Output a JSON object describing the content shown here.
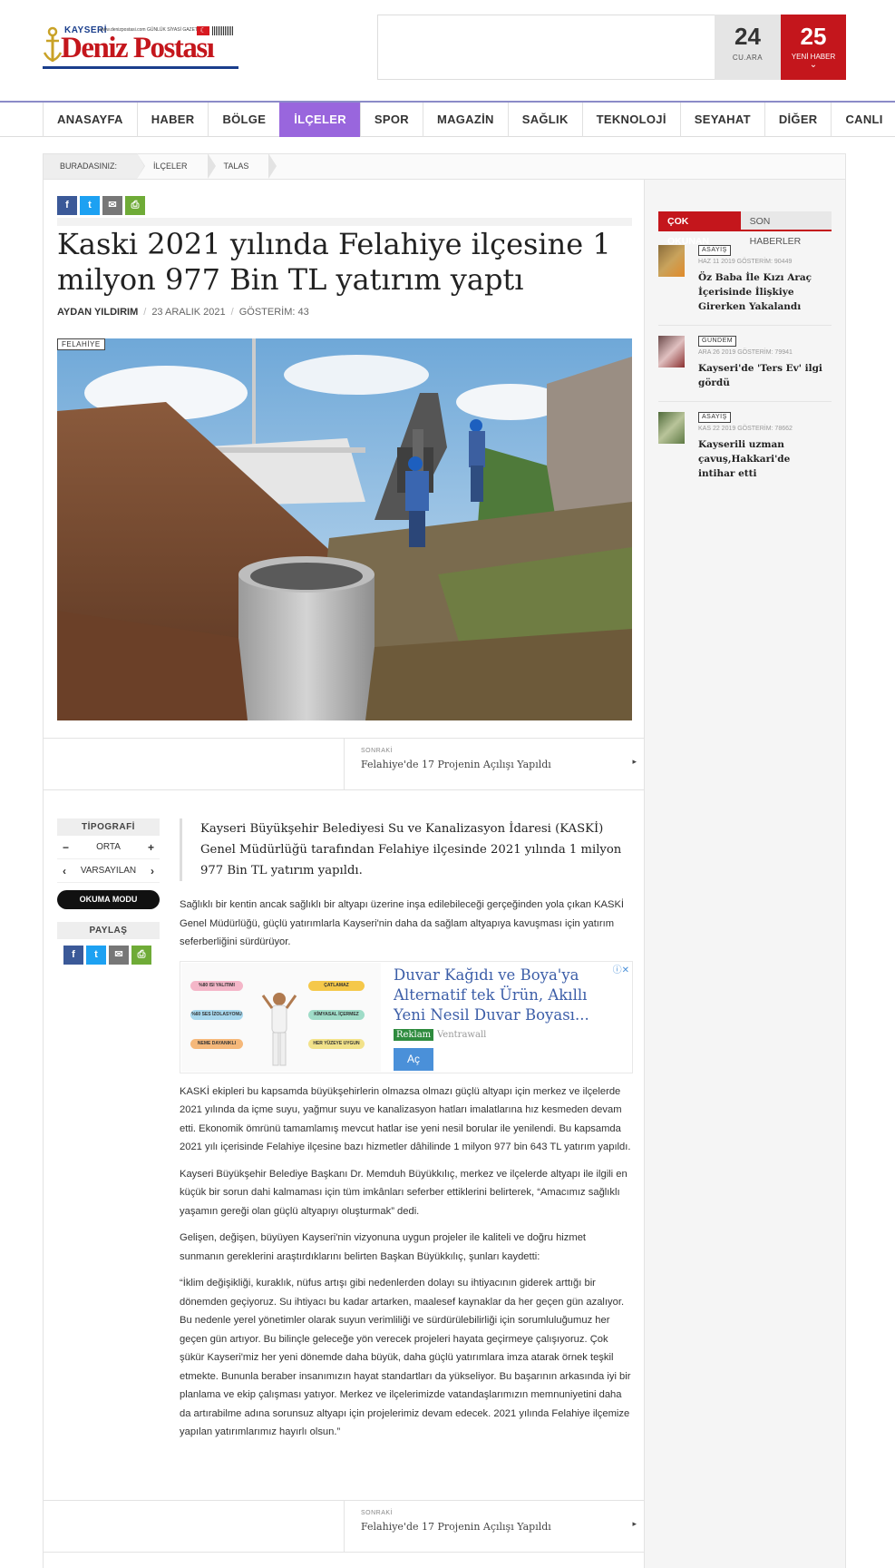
{
  "header": {
    "logo": {
      "top": "KAYSERİ",
      "main": "Deniz Postası",
      "tagline": "www.denizpostasi.com  GÜNLÜK SİYASİ GAZETE"
    },
    "date": {
      "day": "24",
      "weekday": "CU.ARA"
    },
    "news": {
      "count": "25",
      "label": "YENİ HABER"
    }
  },
  "nav": [
    "ANASAYFA",
    "HABER",
    "BÖLGE",
    "İLÇELER",
    "SPOR",
    "MAGAZİN",
    "SAĞLIK",
    "TEKNOLOJİ",
    "SEYAHAT",
    "DİĞER",
    "CANLI"
  ],
  "breadcrumb": [
    "BURADASINIZ:",
    "İLÇELER",
    "TALAS"
  ],
  "article": {
    "title": "Kaski 2021 yılında Felahiye ilçesine 1 milyon 977 Bin TL yatırım yaptı",
    "author": "AYDAN YILDIRIM",
    "date": "23 ARALIK 2021",
    "views": "GÖSTERİM: 43",
    "category": "FELAHİYE",
    "lead": "Kayseri Büyükşehir Belediyesi Su ve Kanalizasyon İdaresi (KASKİ) Genel Müdürlüğü tarafından Felahiye ilçesinde 2021 yılında 1 milyon 977 Bin TL yatırım yapıldı.",
    "paragraphs": [
      "Sağlıklı bir kentin ancak sağlıklı bir altyapı üzerine inşa edilebileceği gerçeğinden yola çıkan KASKİ Genel Müdürlüğü, güçlü yatırımlarla Kayseri'nin daha da sağlam altyapıya kavuşması için yatırım seferberliğini sürdürüyor.",
      "KASKİ ekipleri bu kapsamda büyükşehirlerin olmazsa olmazı güçlü altyapı için merkez ve ilçelerde 2021 yılında da içme suyu, yağmur suyu ve kanalizasyon hatları imalatlarına hız kesmeden devam etti. Ekonomik ömrünü tamamlamış mevcut hatlar ise yeni nesil borular ile yenilendi. Bu kapsamda 2021 yılı içerisinde Felahiye ilçesine bazı hizmetler dâhilinde 1 milyon 977 bin 643 TL yatırım yapıldı.",
      "Kayseri Büyükşehir Belediye Başkanı Dr. Memduh Büyükkılıç, merkez ve ilçelerde altyapı ile ilgili en küçük bir sorun dahi kalmaması için tüm imkânları seferber ettiklerini belirterek, “Amacımız sağlıklı yaşamın gereği olan güçlü altyapıyı oluşturmak” dedi.",
      "Gelişen, değişen, büyüyen Kayseri'nin vizyonuna uygun projeler ile kaliteli ve doğru hizmet sunmanın gereklerini araştırdıklarını belirten Başkan Büyükkılıç, şunları kaydetti:",
      "“İklim değişikliği, kuraklık, nüfus artışı gibi nedenlerden dolayı su ihtiyacının giderek arttığı bir dönemden geçiyoruz. Su ihtiyacı bu kadar artarken, maalesef kaynaklar da her geçen gün azalıyor. Bu nedenle yerel yönetimler olarak suyun verimliliği ve sürdürülebilirliği için sorumluluğumuz her geçen gün artıyor. Bu bilinçle geleceğe yön verecek projeleri hayata geçirmeye çalışıyoruz. Çok şükür Kayseri'miz her yeni dönemde daha büyük, daha güçlü yatırımlara imza atarak örnek teşkil etmekte. Bununla beraber insanımızın hayat standartları da yükseliyor. Bu başarının arkasında iyi bir planlama ve ekip çalışması yatıyor. Merkez ve ilçelerimizde vatandaşlarımızın memnuniyetini daha da artırabilme adına sorunsuz altyapı için projelerimiz devam edecek. 2021 yılında Felahiye ilçemize yapılan yatırımlarımız hayırlı olsun.”"
    ],
    "next": {
      "label": "SONRAKİ",
      "title": "Felahiye'de 17 Projenin Açılışı Yapıldı"
    }
  },
  "tools": {
    "typography": "TİPOGRAFİ",
    "size": "ORTA",
    "font": "VARSAYILAN",
    "reader": "OKUMA MODU",
    "share": "PAYLAŞ"
  },
  "ad": {
    "title": "Duvar Kağıdı ve Boya'ya Alternatif tek Ürün, Akıllı Yeni Nesil Duvar Boyası...",
    "badge": "Reklam",
    "source": "Ventrawall",
    "button": "Aç",
    "pills": [
      "%80 ISI YALITIMI",
      "ÇATLAMAZ",
      "%60 SES İZOLASYONU",
      "KİMYASAL İÇERMEZ",
      "NEME DAYANIKLI",
      "HER YÜZEYE UYGUN"
    ]
  },
  "sidebar": {
    "tabs": [
      "ÇOK OKUNAN",
      "SON HABERLER"
    ],
    "items": [
      {
        "tag": "ASAYİŞ",
        "meta": "HAZ 11 2019  GÖSTERİM: 90449",
        "title": "Öz Baba İle Kızı Araç İçerisinde İlişkiye Girerken Yakalandı"
      },
      {
        "tag": "GÜNDEM",
        "meta": "ARA 26 2019  GÖSTERİM: 79941",
        "title": "Kayseri'de 'Ters Ev' ilgi gördü"
      },
      {
        "tag": "ASAYİŞ",
        "meta": "KAS 22 2019  GÖSTERİM: 78662",
        "title": "Kayserili uzman çavuş,Hakkari'de intihar etti"
      }
    ]
  },
  "colors": {
    "brand_red": "#c4161c",
    "nav_active": "#9966dd",
    "logo_blue": "#1a3e8c"
  }
}
